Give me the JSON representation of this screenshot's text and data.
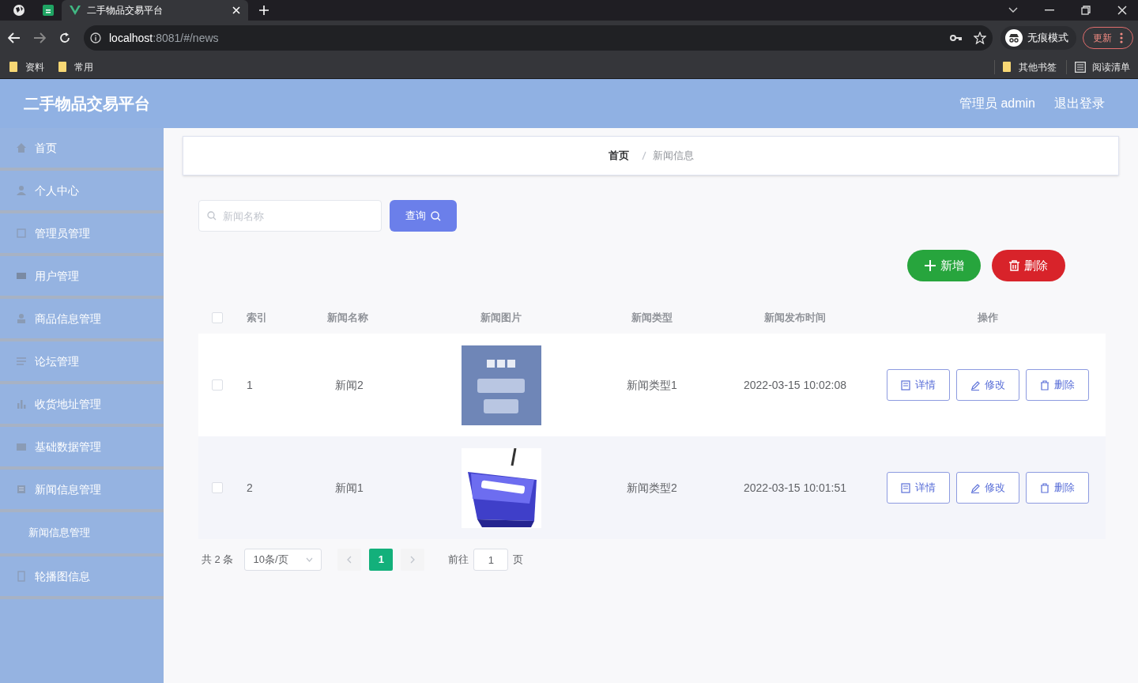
{
  "browser": {
    "tabs": [
      {
        "title": "二手物品交易平台",
        "selected": true
      }
    ],
    "address": {
      "host": "localhost",
      "path": ":8081/#/news"
    },
    "profile": "无痕模式",
    "update": "更新",
    "bookmarks": [
      "资料",
      "常用"
    ],
    "other_bookmarks": "其他书签",
    "reading_list": "阅读清单"
  },
  "header": {
    "title": "二手物品交易平台",
    "user": "管理员 admin",
    "logout": "退出登录"
  },
  "sidebar": {
    "items": [
      {
        "label": "首页"
      },
      {
        "label": "个人中心"
      },
      {
        "label": "管理员管理"
      },
      {
        "label": "用户管理"
      },
      {
        "label": "商品信息管理"
      },
      {
        "label": "论坛管理"
      },
      {
        "label": "收货地址管理"
      },
      {
        "label": "基础数据管理"
      },
      {
        "label": "新闻信息管理",
        "children": [
          {
            "label": "新闻信息管理"
          }
        ]
      },
      {
        "label": "轮播图信息"
      }
    ]
  },
  "breadcrumb": [
    "首页",
    "新闻信息"
  ],
  "search": {
    "placeholder": "新闻名称",
    "button": "查询"
  },
  "actions": {
    "add": "新增",
    "delete": "删除"
  },
  "table": {
    "all_checked": false,
    "columns": [
      "索引",
      "新闻名称",
      "新闻图片",
      "新闻类型",
      "新闻发布时间",
      "操作"
    ],
    "rows": [
      {
        "checked": false,
        "index": "1",
        "name": "新闻2",
        "type": "新闻类型1",
        "time": "2022-03-15 10:02:08",
        "buttons": [
          "详情",
          "修改",
          "删除"
        ]
      },
      {
        "checked": false,
        "index": "2",
        "name": "新闻1",
        "type": "新闻类型2",
        "time": "2022-03-15 10:01:51",
        "buttons": [
          "详情",
          "修改",
          "删除"
        ]
      }
    ]
  },
  "pagination": {
    "total": "共 2 条",
    "page_size": "10条/页",
    "pages": [
      {
        "label": "1",
        "selected": true
      }
    ],
    "goto": "前往",
    "goto_value": "1",
    "goto_suffix": "页"
  }
}
